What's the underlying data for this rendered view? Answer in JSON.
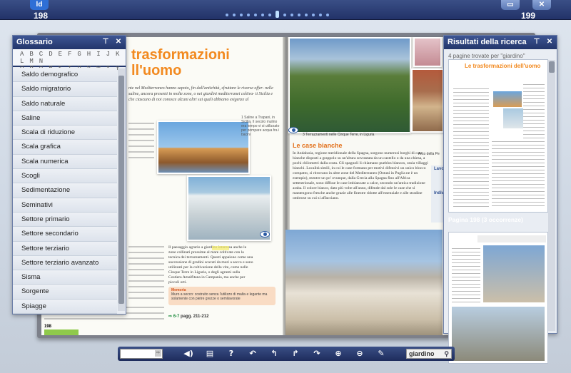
{
  "header": {
    "logo": "ld",
    "left_page": "198",
    "right_page": "199",
    "nav_dots": 15,
    "active_dot": 8
  },
  "book": {
    "left_title_line1": "trasformazioni",
    "left_title_line2": "ll'uomo",
    "left_intro": "nte nel Mediterraneo hanno sapoto, fin dall'antichità, sfruttare le risorse offer- nelle saline, ancora presenti in molte zone, o nei giardini mediterranei coltiva- ti Sicilia e che ciascuno di noi conosce alcuni altri sui quali abbiamo esigenze al",
    "caption_1": "1 Saline a Trapani, in Sicilia. Il secolo mulino era tempo vi si utilizzato per pompare acqua fra i bacini",
    "left_column": "Il paesaggio agrario a giardino interessa anche le zone collinari prossime al mare coltivate con la tecnica dei terrazzamenti. Questi appaiono come una successione di gradini scavati da muri a secco e sono utilizzati per la coltivazione della vite, come nelle Cinque Terre in Liguria, o degli agrumi sulla Costiera Amalfitana in Campania, ma anche per piccoli orti.",
    "highlight_word": "giardino",
    "memo_label": "Memoria",
    "memo_text": "Muro a secco: costruito senza l'utilizzo di malta e legante ma solamente con pietre grezze o semilavorate",
    "vedi_label": "6-7",
    "vedi_pages": "pagg. 211-212",
    "right_caption": "3 Terrazzamenti nelle Cinque Terre, in Liguria",
    "right_caption_2": "Arco della Pe",
    "right_subheading": "Le case bianche",
    "right_body": "In Andalusia, regione meridionale della Spagna, sorgono numerosi borghi di case bianche disposti a grappolo su un'altura sovrastata da un castello o da una chiesa, a pochi chilometri dalla costa. Gli spagnoli li chiamano pueblos blancos, ossia villaggi bianchi. Località simili, in cui le case formano per motivi difensivi un unico blocco compatto, si ritrovano in altre zone del Mediterraneo (Ostuni in Puglia ne è un esempio), mentre un po' ovunque, dalla Grecia alla Spagna fino all'Africa settentrionale, sono diffuse le case imbiancate a calce, secondo un'antica tradizione araba. Il colore bianco, dato più volte all'anno, difende dal sole le case che si mantengono fresche anche grazie alle finestre ridotte all'essenziale e alle stradine ombrose su cui si affacciano.",
    "side_head_1": "Lavora sul",
    "side_head_2": "Individua le",
    "left_page_number": "198"
  },
  "glossary": {
    "title": "Glossario",
    "alphabet_line1": "A B C D E F G H I J K L M N",
    "alphabet_line2": "O P Q R S T U V W X Y Z",
    "items": [
      "Saldo demografico",
      "Saldo migratorio",
      "Saldo naturale",
      "Saline",
      "Scala di riduzione",
      "Scala grafica",
      "Scala numerica",
      "Scogli",
      "Sedimentazione",
      "Seminativi",
      "Settore primario",
      "Settore secondario",
      "Settore terziario",
      "Settore terziario avanzato",
      "Sisma",
      "Sorgente",
      "Spiagge"
    ]
  },
  "results": {
    "title": "Risultati della ricerca",
    "count_text": "4 pagine trovate per \"giardino\"",
    "thumb_title": "Le trasformazioni dell'uomo",
    "page_label": "Pagina 198 (3 occorrenze)"
  },
  "toolbar": {
    "search_value": "giardino",
    "page_input": "",
    "icons": [
      "speaker-icon",
      "book-icon",
      "help-icon",
      "undo-icon",
      "back-icon",
      "forward-icon",
      "redo-icon",
      "zoom-in-icon",
      "zoom-out-icon",
      "pen-icon"
    ]
  }
}
